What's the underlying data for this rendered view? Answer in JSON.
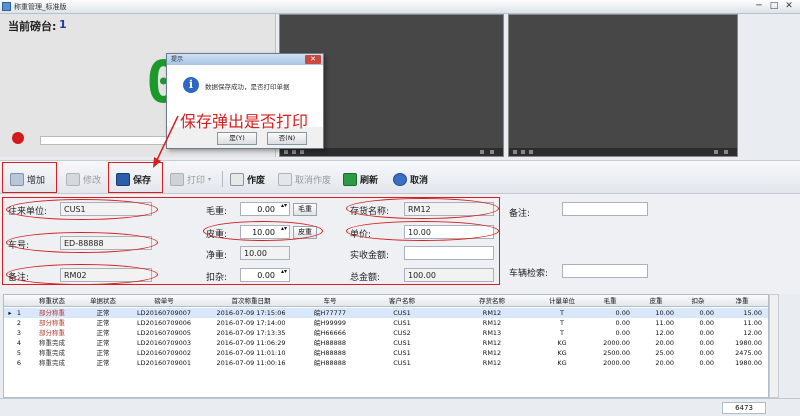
{
  "window": {
    "title": "称重管理_标准版",
    "controls": [
      "─",
      "□",
      "✕"
    ]
  },
  "weigh": {
    "platform_label": "当前磅台:",
    "platform_num": "1",
    "weight": "0"
  },
  "toolbar": [
    {
      "label": "增加",
      "icon": "add-icon",
      "state": "normal",
      "boxed": true
    },
    {
      "label": "修改",
      "icon": "edit-icon",
      "state": "disabled",
      "boxed": false
    },
    {
      "label": "保存",
      "icon": "save-icon",
      "state": "bold",
      "boxed": true
    },
    {
      "label": "打印",
      "icon": "print-icon",
      "state": "disabled",
      "boxed": false
    },
    {
      "label": "作废",
      "icon": "void-icon",
      "state": "bold",
      "boxed": false
    },
    {
      "label": "取消作废",
      "icon": "unvoid-icon",
      "state": "disabled",
      "boxed": false
    },
    {
      "label": "刷新",
      "icon": "refresh-icon",
      "state": "bold",
      "boxed": false
    },
    {
      "label": "取消",
      "icon": "cancel-icon",
      "state": "bold",
      "boxed": false
    }
  ],
  "form": {
    "customer_label": "往来单位:",
    "customer_value": "CUS1",
    "plate_label": "车号:",
    "plate_value": "ED-88888",
    "goods_label": "备注:",
    "goods_value": "RM02",
    "gross_label": "毛重:",
    "gross_value": "0.00",
    "gross_btn": "毛重",
    "tare_label": "皮重:",
    "tare_value": "10.00",
    "tare_btn": "皮重",
    "net_label": "净重:",
    "net_value": "10.00",
    "deduct_label": "扣杂:",
    "deduct_value": "0.00",
    "item_label": "存货名称:",
    "item_value": "RM12",
    "price_label": "单价:",
    "price_value": "10.00",
    "paid_label": "实收金额:",
    "paid_value": "",
    "total_label": "总金额:",
    "total_value": "100.00",
    "note_label": "备注:",
    "note_value": "",
    "search_label": "车辆检索:",
    "search_value": ""
  },
  "grid": {
    "columns": [
      "称重状态",
      "单据状态",
      "磅单号",
      "首次称重日期",
      "车号",
      "客户名称",
      "存货名称",
      "计量单位",
      "毛重",
      "皮重",
      "扣杂",
      "净重"
    ],
    "rows": [
      {
        "n": "1",
        "status": "部分称重",
        "doc": "正常",
        "no": "LD20160709007",
        "date": "2016-07-09 17:15:06",
        "plate": "皖H77777",
        "cust": "CUS1",
        "item": "RM12",
        "unit": "T",
        "gross": "0.00",
        "tare": "10.00",
        "deduct": "0.00",
        "net": "15.00",
        "status_color": "#c0392b"
      },
      {
        "n": "2",
        "status": "部分称重",
        "doc": "正常",
        "no": "LD20160709006",
        "date": "2016-07-09 17:14:00",
        "plate": "皖H99999",
        "cust": "CUS1",
        "item": "RM12",
        "unit": "T",
        "gross": "0.00",
        "tare": "11.00",
        "deduct": "0.00",
        "net": "11.00",
        "status_color": "#c0392b"
      },
      {
        "n": "3",
        "status": "部分称重",
        "doc": "正常",
        "no": "LD20160709005",
        "date": "2016-07-09 17:13:35",
        "plate": "皖H66666",
        "cust": "CUS2",
        "item": "RM13",
        "unit": "T",
        "gross": "0.00",
        "tare": "12.00",
        "deduct": "0.00",
        "net": "12.00",
        "status_color": "#c0392b"
      },
      {
        "n": "4",
        "status": "称重完成",
        "doc": "正常",
        "no": "LD20160709003",
        "date": "2016-07-09 11:06:29",
        "plate": "皖H88888",
        "cust": "CUS1",
        "item": "RM12",
        "unit": "KG",
        "gross": "2000.00",
        "tare": "20.00",
        "deduct": "0.00",
        "net": "1980.00",
        "status_color": "#333333"
      },
      {
        "n": "5",
        "status": "称重完成",
        "doc": "正常",
        "no": "LD20160709002",
        "date": "2016-07-09 11:01:10",
        "plate": "皖H88888",
        "cust": "CUS1",
        "item": "RM12",
        "unit": "KG",
        "gross": "2500.00",
        "tare": "25.00",
        "deduct": "0.00",
        "net": "2475.00",
        "status_color": "#333333"
      },
      {
        "n": "6",
        "status": "称重完成",
        "doc": "正常",
        "no": "LD20160709001",
        "date": "2016-07-09 11:00:16",
        "plate": "皖H88888",
        "cust": "CUS1",
        "item": "RM12",
        "unit": "KG",
        "gross": "2000.00",
        "tare": "20.00",
        "deduct": "0.00",
        "net": "1980.00",
        "status_color": "#333333"
      }
    ],
    "selected_marker": "▸"
  },
  "footer": {
    "total": "6473"
  },
  "dialog": {
    "title": "提示",
    "message": "数据保存成功，是否打印单据",
    "yes": "是(Y)",
    "no": "否(N)"
  },
  "annotation": "保存弹出是否打印"
}
